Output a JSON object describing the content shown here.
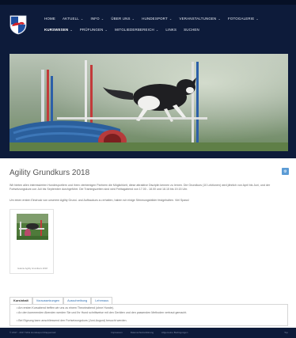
{
  "header": {
    "nav_items": [
      {
        "label": "Home",
        "has_chevron": false,
        "active": false
      },
      {
        "label": "Aktuell",
        "has_chevron": true,
        "active": false
      },
      {
        "label": "Info",
        "has_chevron": true,
        "active": false
      },
      {
        "label": "Über uns",
        "has_chevron": true,
        "active": false
      },
      {
        "label": "Hundesport",
        "has_chevron": true,
        "active": false
      },
      {
        "label": "Veranstaltungen",
        "has_chevron": true,
        "active": false
      },
      {
        "label": "Fotogalerie",
        "has_chevron": true,
        "active": false
      },
      {
        "label": "Kurswesen",
        "has_chevron": true,
        "active": true
      },
      {
        "label": "Prüfungen",
        "has_chevron": true,
        "active": false
      },
      {
        "label": "Mitgliederbereich",
        "has_chevron": true,
        "active": false
      },
      {
        "label": "Links",
        "has_chevron": false,
        "active": false
      },
      {
        "label": "Suchen",
        "has_chevron": false,
        "active": false
      }
    ],
    "chevron_glyph": "⌄"
  },
  "article": {
    "title": "Agility Grundkurs 2018",
    "edit_icon": "gear-icon",
    "paragraph_1": "Wir bieten allen interessierten Hundesportlern und ihren vierbeinigen Partnern die Möglichkeit, diese attraktive Disziplin kennen zu lernen. Die Grundkurs (10 Lektionen) wird jährlich von April bis Juni, und der Fortsetzungskurs von Juli bis September durchgeführt. Die Trainingszeiten sind wird Freitagabend von 17.00 - 18.00 und 18.15 bis 19.15 Uhr.",
    "paragraph_2": "Um einen ersten Eindruck von unserem Agility Grund- und Aufbaukurs zu erhalten, haben wir einige Stimmungsbilder festgehalten. Viel Spass!",
    "gallery_caption": "Galerie Agility Grundkurs 2018"
  },
  "tabs": {
    "items": [
      "Kursinhalt",
      "Voraussetzungen",
      "Ausschreibung",
      "Lehrmaus"
    ],
    "active_index": 0,
    "panel_lines": [
      "• Am ersten Kursabend treffen wir uns zu einem Theorieabend (ohne Hunde).",
      "• An den kommenden Abenden werden Sie und Ihr Hund schrittweise mit den Geräten und den passenden Methoden vertraut gemacht.",
      "• Bei Eignung kann anschliessend den Fortsetzungskurs (Juni-August) besucht werden."
    ]
  },
  "footer": {
    "copyright": "© 2017 - 2017 SKG Hundesport Rapperswil",
    "links": [
      "Impressum",
      "Datenschutzerklärung",
      "Allgemeine Bedingungen"
    ],
    "top_link": "Top"
  },
  "colors": {
    "header_bg": "#0d1b3a",
    "accent_blue": "#2f6fb1",
    "edit_button": "#5b9bd5"
  }
}
